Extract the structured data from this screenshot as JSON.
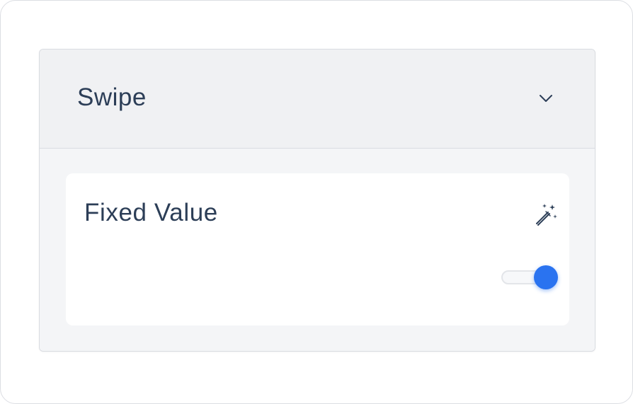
{
  "panel": {
    "title": "Swipe",
    "expanded": true,
    "chevron_icon": "chevron-down-icon"
  },
  "card": {
    "label": "Fixed Value",
    "wand_icon": "magic-wand-icon",
    "toggle": {
      "on": true,
      "accent_color": "#2a73f0"
    }
  },
  "colors": {
    "text": "#2c3e57",
    "header_bg": "#f0f1f3",
    "body_bg": "#f4f5f7",
    "card_bg": "#ffffff",
    "border": "#d9dce1"
  }
}
